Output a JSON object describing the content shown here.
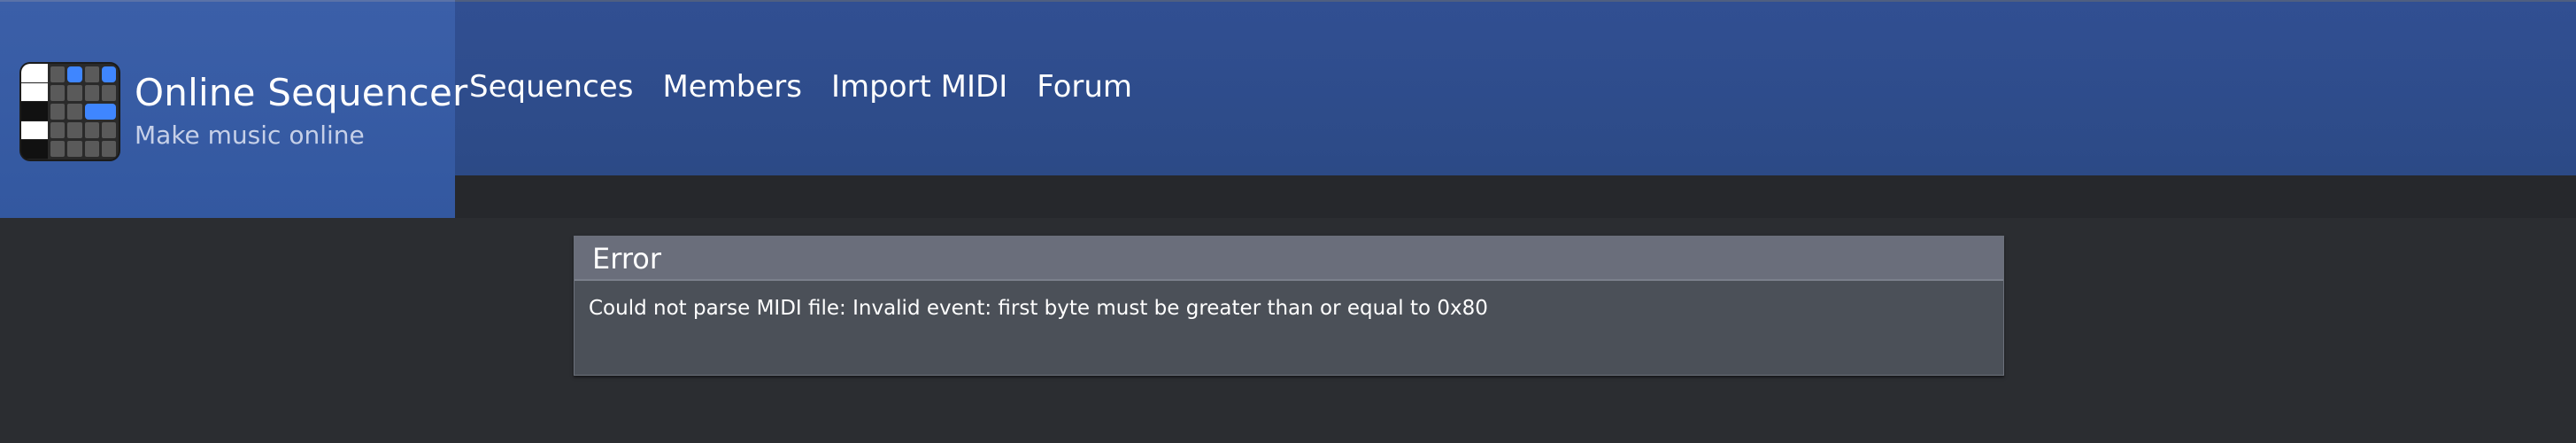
{
  "brand": {
    "title": "Online Sequencer",
    "tagline": "Make music online",
    "logo_icon": "piano-roll-icon"
  },
  "nav": {
    "items": [
      {
        "label": "Sequences"
      },
      {
        "label": "Members"
      },
      {
        "label": "Import MIDI"
      },
      {
        "label": "Forum"
      }
    ]
  },
  "error": {
    "title": "Error",
    "message": "Could not parse MIDI file: Invalid event: first byte must be greater than or equal to 0x80"
  },
  "colors": {
    "header": "#2c4a86",
    "brand": "#3358a0",
    "background": "#2b2d31",
    "error_title_bar": "#6a6e7b",
    "error_body": "#4b5058",
    "accent_note": "#3f86ff"
  }
}
